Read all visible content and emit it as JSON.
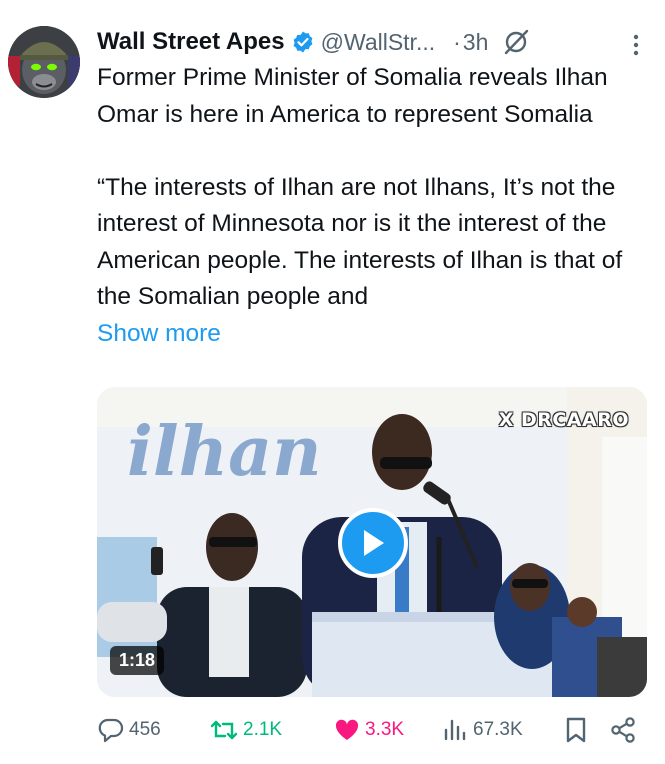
{
  "author": {
    "name": "Wall Street Apes",
    "handle": "@WallStr...",
    "separator": "·",
    "time": "3h",
    "verified_color": "#1d9bf0"
  },
  "tweet": {
    "line1": "Former Prime Minister of Somalia reveals Ilhan Omar is here in America to represent Somalia",
    "line2": "“The interests of Ilhan are not Ilhans, It’s not the interest of Minnesota nor is it the interest of the American people. The interests of Ilhan is that of the Somalian people and",
    "show_more": "Show more"
  },
  "media": {
    "watermark": "X DRCAARO",
    "banner_text": "ilhan",
    "duration": "1:18",
    "play_color": "#1d9bf0"
  },
  "actions": {
    "replies": "456",
    "retweets": "2.1K",
    "likes": "3.3K",
    "views": "67.3K"
  },
  "icons": {
    "reply": "reply-icon",
    "retweet": "retweet-icon",
    "like": "heart-icon",
    "views": "views-icon",
    "bookmark": "bookmark-icon",
    "share": "share-icon",
    "more": "more-icon",
    "grok": "grok-icon"
  }
}
